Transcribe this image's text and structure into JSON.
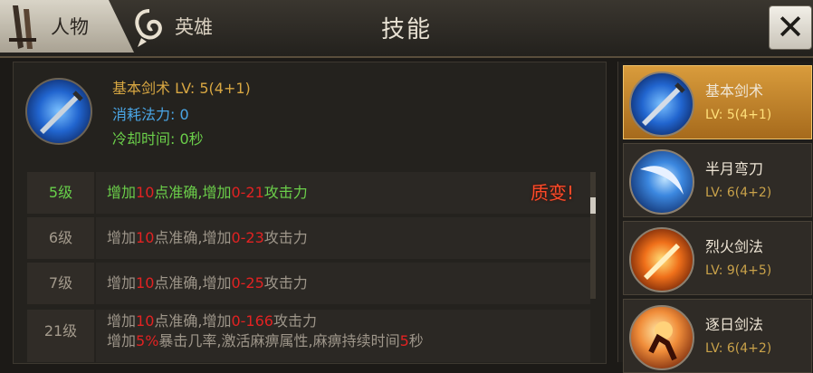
{
  "header": {
    "tab_people": "人物",
    "tab_hero": "英雄",
    "title": "技能",
    "close_label": "✕"
  },
  "selected_skill": {
    "name_line": "基本剑术 LV: 5(4+1)",
    "mana_line": "消耗法力: 0",
    "cooldown_line": "冷却时间: 0秒"
  },
  "levels": [
    {
      "level": "5级",
      "parts": [
        "增加",
        "10",
        "点准确,增加",
        "0-21",
        "攻击力"
      ],
      "badge": "质变!"
    },
    {
      "level": "6级",
      "parts": [
        "增加",
        "10",
        "点准确,增加",
        "0-23",
        "攻击力"
      ]
    },
    {
      "level": "7级",
      "parts": [
        "增加",
        "10",
        "点准确,增加",
        "0-25",
        "攻击力"
      ]
    },
    {
      "level": "21级",
      "line1_parts": [
        "增加",
        "10",
        "点准确,增加",
        "0-166",
        "攻击力"
      ],
      "line2_parts": [
        "增加",
        "5%",
        "暴击几率,激活麻痹属性,麻痹持续时间",
        "5",
        "秒"
      ]
    }
  ],
  "skills": [
    {
      "name": "基本剑术",
      "lv": "LV: 5(4+1)",
      "icon": "sword-icon"
    },
    {
      "name": "半月弯刀",
      "lv": "LV: 6(4+2)",
      "icon": "crescent-blade-icon"
    },
    {
      "name": "烈火剑法",
      "lv": "LV: 9(4+5)",
      "icon": "fire-sword-icon"
    },
    {
      "name": "逐日剑法",
      "lv": "LV: 6(4+2)",
      "icon": "sun-sword-icon"
    }
  ]
}
